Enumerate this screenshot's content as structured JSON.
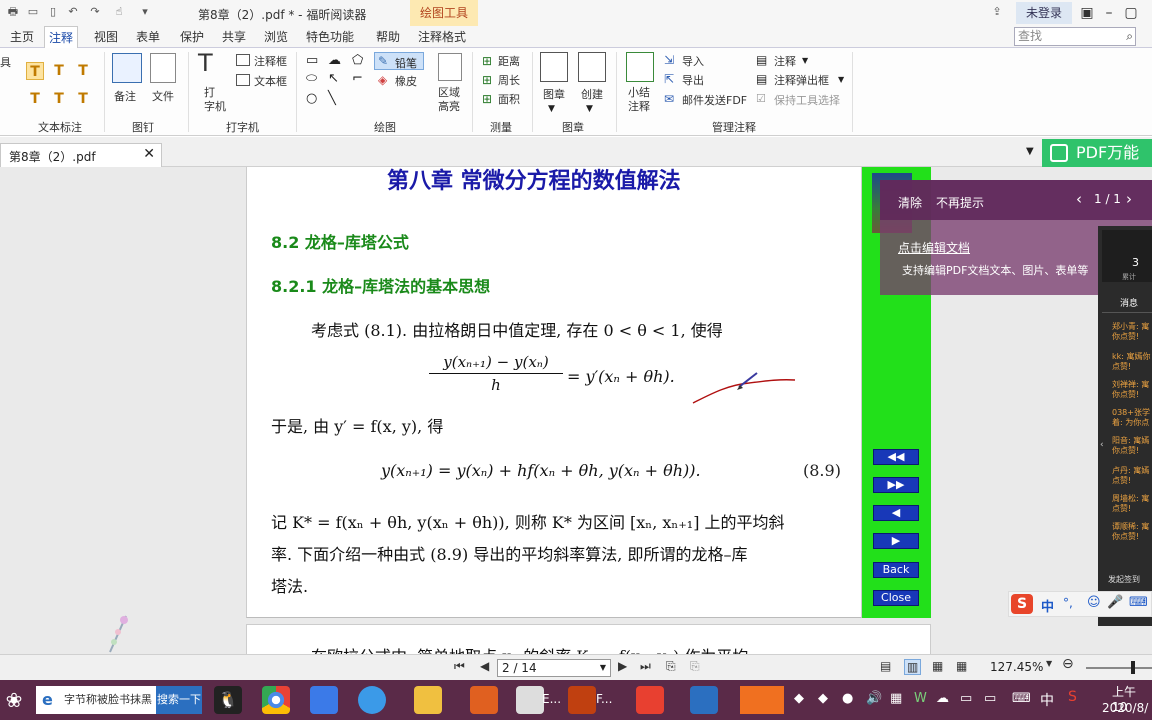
{
  "titlebar": {
    "title": "第8章（2）.pdf * - 福昕阅读器",
    "context_tab": "绘图工具",
    "login": "未登录"
  },
  "menu": {
    "tabs": [
      "主页",
      "注释",
      "视图",
      "表单",
      "保护",
      "共享",
      "浏览",
      "特色功能",
      "帮助",
      "注释格式"
    ],
    "active": "注释",
    "search_placeholder": "查找"
  },
  "ribbon": {
    "left_cut": "具",
    "groups": {
      "text_markup": "文本标注",
      "pin": "图钉",
      "typewriter": "打字机",
      "drawing": "绘图",
      "measure": "测量",
      "stamp": "图章",
      "manage": "管理注释"
    },
    "items": {
      "note": "备注",
      "file": "文件",
      "typewriter": "打\n字机",
      "callout": "注释框",
      "textbox": "文本框",
      "pencil": "铅笔",
      "eraser": "橡皮",
      "area_highlight": "区域\n高亮",
      "distance": "距离",
      "perimeter": "周长",
      "area": "面积",
      "stamp": "图章",
      "create": "创建",
      "summary": "小结\n注释",
      "import": "导入",
      "export": "导出",
      "email_fdf": "邮件发送FDF",
      "annot": "注释",
      "annot_popup": "注释弹出框",
      "keep_tool": "保持工具选择"
    }
  },
  "doctab": {
    "name": "第8章（2）.pdf",
    "promo": "PDF万能"
  },
  "page": {
    "chapter": "第八章  常微分方程的数值解法",
    "section": "8.2   龙格–库塔公式",
    "subsection": "8.2.1   龙格–库塔法的基本思想",
    "p1": "考虑式 (8.1). 由拉格朗日中值定理, 存在 0 < θ < 1, 使得",
    "eq1_num": "y(xₙ₊₁) − y(xₙ)",
    "eq1_den": "h",
    "eq1_rhs": "= y′(xₙ + θh).",
    "p2": "于是, 由 y′ = f(x, y), 得",
    "eq2": "y(xₙ₊₁) = y(xₙ) + hf(xₙ + θh, y(xₙ + θh)).",
    "eq2_no": "(8.9)",
    "p3a": "记 K* = f(xₙ + θh, y(xₙ + θh)), 则称 K* 为区间 [xₙ, xₙ₊₁] 上的平均斜",
    "p3b": "率. 下面介绍一种由式 (8.9) 导出的平均斜率算法, 即所谓的龙格–库",
    "p3c": "塔法.",
    "page2_text": "在欧拉公式中, 简单地取点 xₙ 的斜率 Kₙ = f(xₙ, yₙ) 作为平均"
  },
  "nav": {
    "first": "◀◀",
    "last": "▶▶",
    "prev": "◀",
    "next": "▶",
    "back": "Back",
    "close": "Close"
  },
  "popup": {
    "clear": "清除",
    "no_remind": "不再提示",
    "counter": "1 / 1",
    "link": "点击编辑文档",
    "desc": "支持编辑PDF文档文本、图片、表单等"
  },
  "live": {
    "count": "3",
    "count_label": "累计",
    "tab": "消息",
    "chats": [
      "郑小青: 寓你点赞!",
      "kk: 寓嫣你点赞!",
      "刘禅禅: 寓你点赞!",
      "038+张学着: 为你点",
      "阳音: 寓嫣你点赞!",
      "卢丹: 寓嫣点赞!",
      "周墙松: 寓点赞!",
      "谭顺稀: 寓你点赞!"
    ],
    "footer": "发起签到"
  },
  "ime": {
    "lang": "中",
    "punct": "°,"
  },
  "status": {
    "page_value": "2 / 14",
    "zoom": "127.45%"
  },
  "taskbar": {
    "search_text": "字节称被脸书抹黑",
    "search_btn": "搜索一下",
    "app_e": "E...",
    "app_f": "F...",
    "tray_lang": "中",
    "time": "上午 10",
    "date": "2020/8/"
  },
  "colors": {
    "heading": "#1a1aa8",
    "section": "#1a8a1a",
    "green_panel": "#22e01a",
    "nav_button": "#1838b8",
    "taskbar": "#5a2a48",
    "ink": "#b01010"
  }
}
